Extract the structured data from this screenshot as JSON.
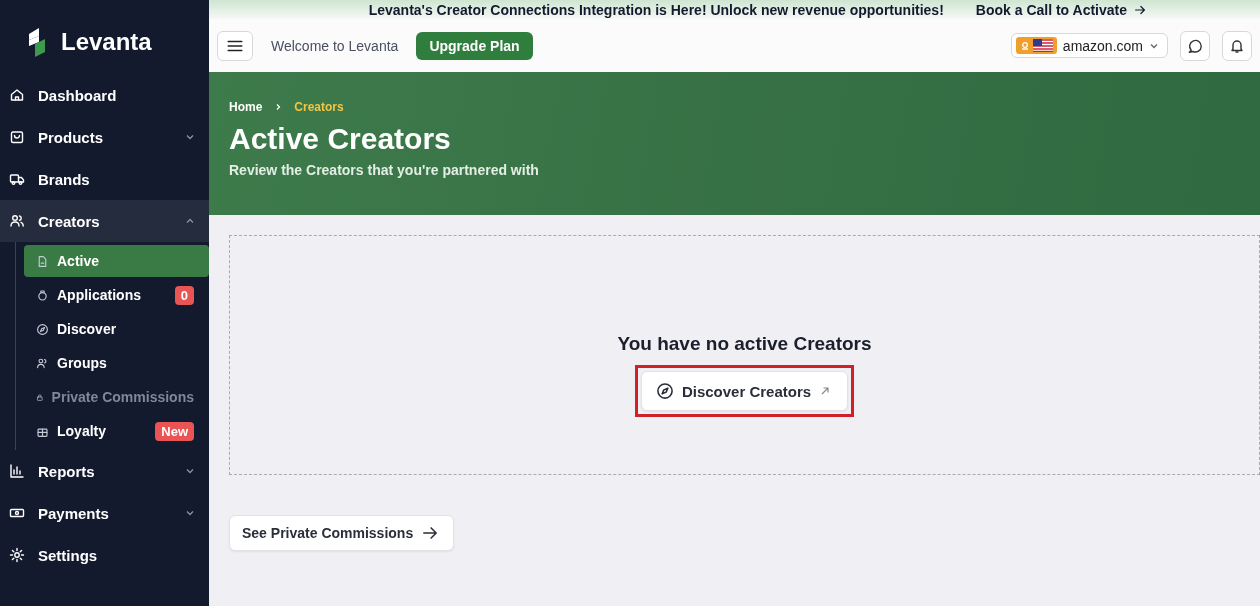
{
  "sidebar": {
    "brand": "Levanta",
    "items": [
      {
        "label": "Dashboard"
      },
      {
        "label": "Products",
        "expanded": false
      },
      {
        "label": "Brands"
      },
      {
        "label": "Creators",
        "expanded": true,
        "children": [
          {
            "label": "Active",
            "selected": true,
            "disabled": false
          },
          {
            "label": "Applications",
            "selected": false,
            "disabled": false,
            "badge": "0"
          },
          {
            "label": "Discover",
            "selected": false,
            "disabled": false
          },
          {
            "label": "Groups",
            "selected": false,
            "disabled": false
          },
          {
            "label": "Private Commissions",
            "selected": false,
            "disabled": true
          },
          {
            "label": "Loyalty",
            "selected": false,
            "disabled": false,
            "badge": "New"
          }
        ]
      },
      {
        "label": "Reports",
        "expanded": false
      },
      {
        "label": "Payments",
        "expanded": false
      },
      {
        "label": "Settings"
      }
    ]
  },
  "banner": {
    "message": "Levanta's Creator Connections Integration is Here! Unlock new revenue opportunities!",
    "link": "Book a Call to Activate"
  },
  "header": {
    "welcome": "Welcome to Levanta",
    "upgrade": "Upgrade Plan",
    "marketplace": "amazon.com"
  },
  "hero": {
    "breadcrumbs": [
      "Home",
      "Creators"
    ],
    "title": "Active Creators",
    "subtitle": "Review the Creators that you're partnered with"
  },
  "empty_state": {
    "message": "You have no active Creators",
    "button": "Discover Creators",
    "annotated": true
  },
  "footer_button": "See Private Commissions"
}
